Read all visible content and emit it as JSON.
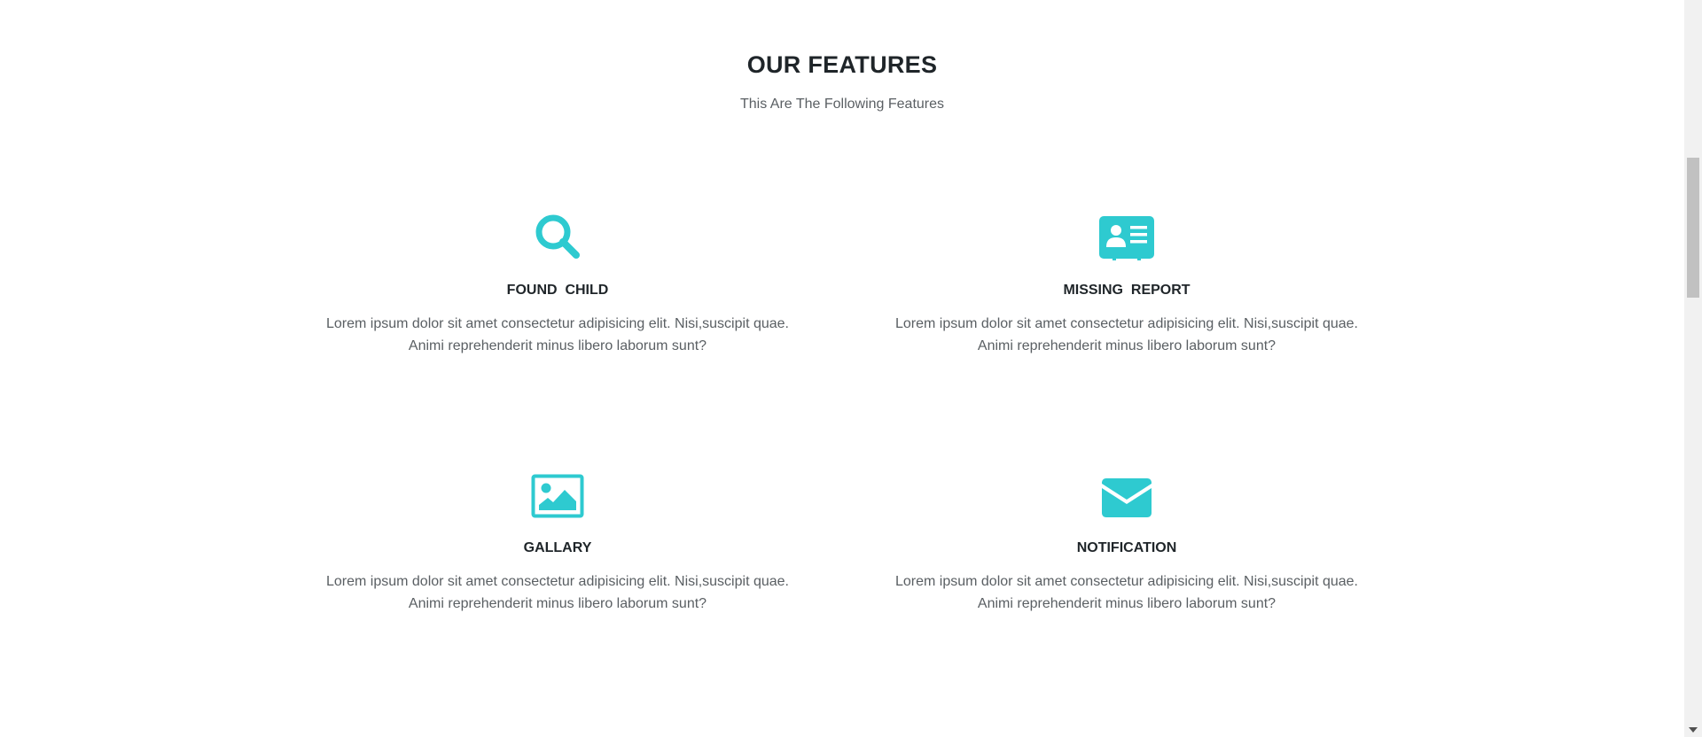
{
  "section": {
    "title": "OUR FEATURES",
    "subtitle": "This Are The Following Features"
  },
  "colors": {
    "accent": "#2ecad0",
    "heading": "#1f2529",
    "body_text": "#5a5f63"
  },
  "features": [
    {
      "icon": "search-icon",
      "title": "FOUND  CHILD",
      "description": "Lorem ipsum dolor sit amet consectetur adipisicing elit. Nisi,suscipit quae. Animi reprehenderit minus libero laborum sunt?"
    },
    {
      "icon": "id-card-icon",
      "title": "MISSING  REPORT",
      "description": "Lorem ipsum dolor sit amet consectetur adipisicing elit. Nisi,suscipit quae. Animi reprehenderit minus libero laborum sunt?"
    },
    {
      "icon": "image-icon",
      "title": "GALLARY",
      "description": "Lorem ipsum dolor sit amet consectetur adipisicing elit. Nisi,suscipit quae. Animi reprehenderit minus libero laborum sunt?"
    },
    {
      "icon": "envelope-icon",
      "title": "NOTIFICATION",
      "description": "Lorem ipsum dolor sit amet consectetur adipisicing elit. Nisi,suscipit quae. Animi reprehenderit minus libero laborum sunt?"
    }
  ]
}
